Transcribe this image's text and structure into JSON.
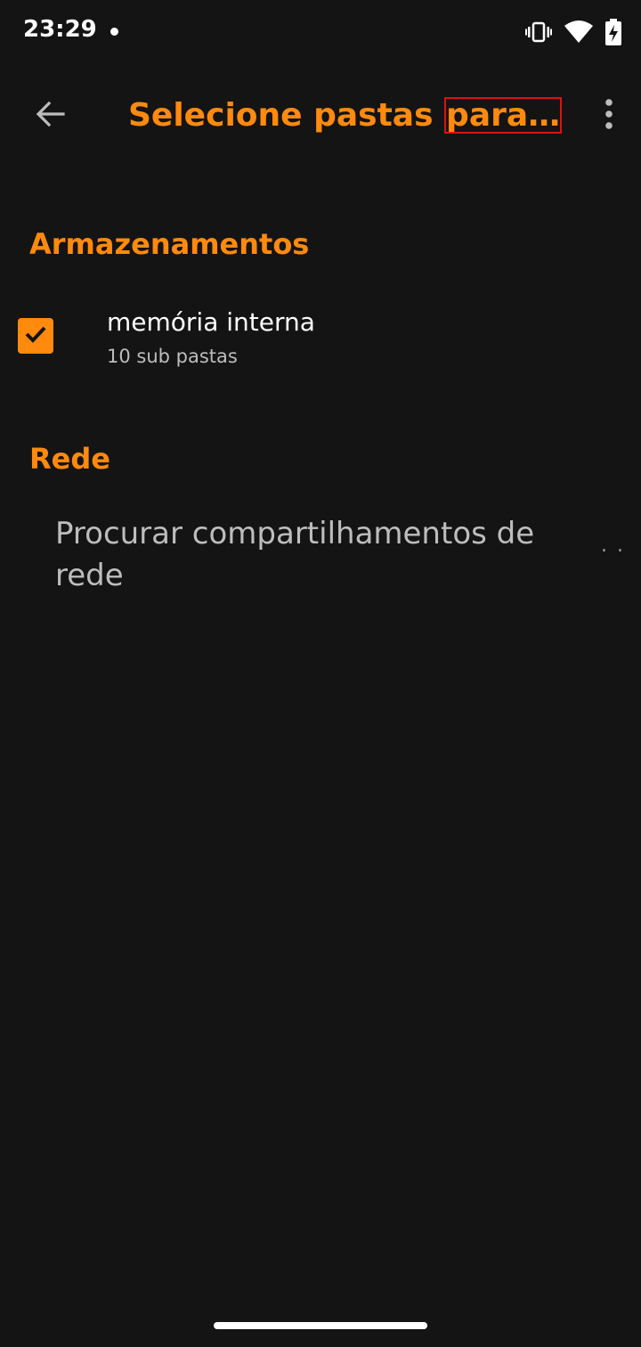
{
  "status_bar": {
    "time": "23:29",
    "icons": [
      "notification-dot-icon",
      "vibrate-icon",
      "wifi-icon",
      "battery-charging-icon"
    ]
  },
  "app_bar": {
    "title_main": "Selecione pastas ",
    "title_highlight": "para…",
    "back_icon": "arrow-back-icon",
    "menu_icon": "more-vert-icon"
  },
  "sections": {
    "storage": {
      "header": "Armazenamentos",
      "items": [
        {
          "title": "memória interna",
          "subtitle": "10 sub pastas",
          "checked": true
        }
      ]
    },
    "network": {
      "header": "Rede",
      "browse_label": "Procurar compartilhamentos de rede"
    }
  },
  "colors": {
    "background": "#141414",
    "accent": "#ff8a0d",
    "text_primary": "#ffffff",
    "text_secondary": "#bdbdbd",
    "highlight_box": "#e01010"
  }
}
